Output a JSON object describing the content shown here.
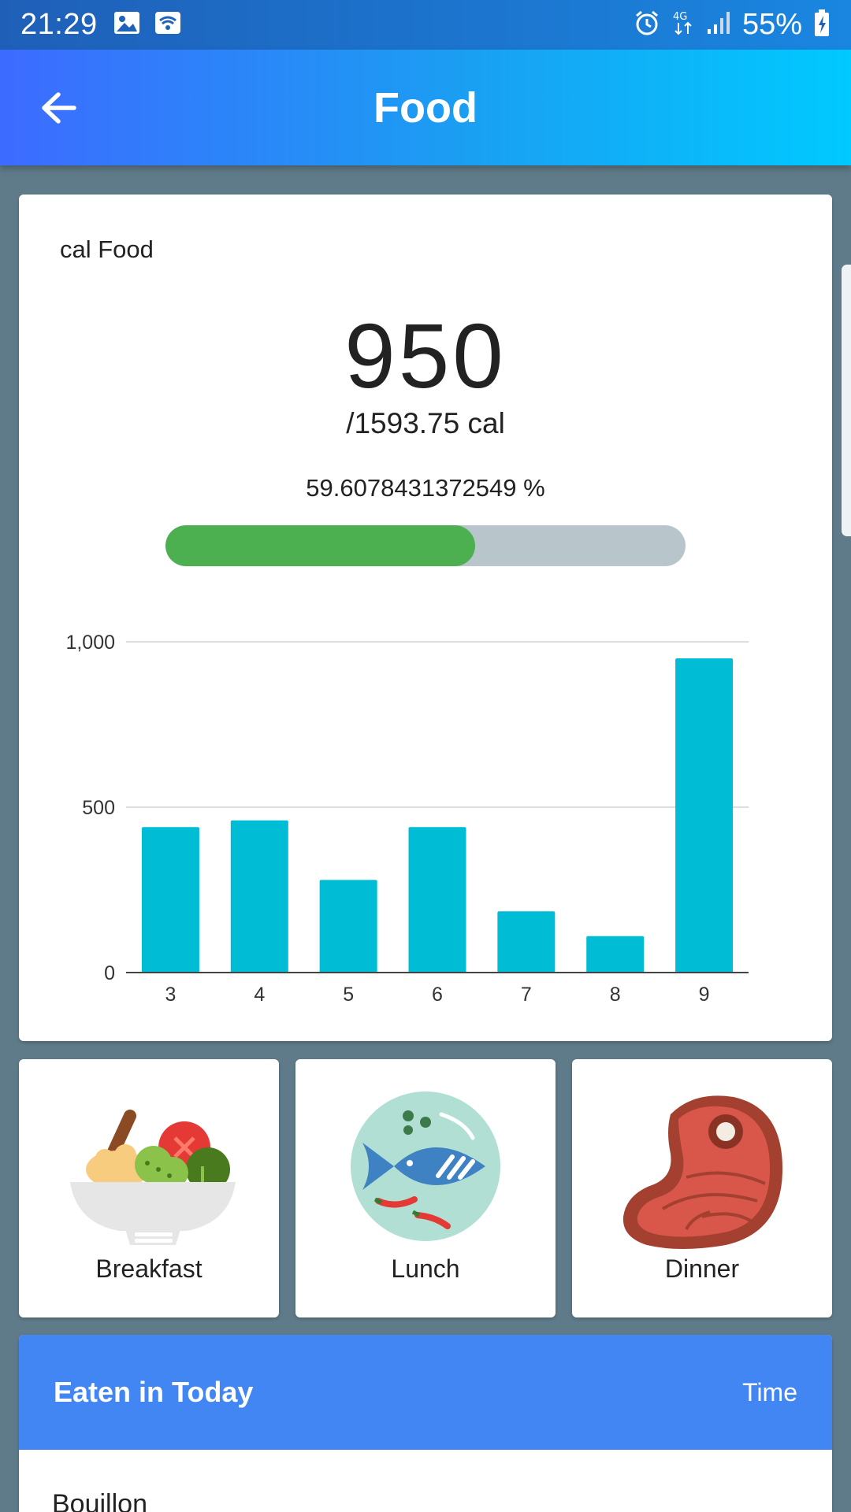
{
  "status_bar": {
    "time": "21:29",
    "battery": "55%",
    "network": "4G",
    "icons": [
      "image-icon",
      "wifi-icon",
      "alarm-icon",
      "network-4g-icon",
      "signal-icon",
      "battery-charging-icon"
    ]
  },
  "app_bar": {
    "title": "Food",
    "back_icon": "arrow-back-icon"
  },
  "summary": {
    "label": "cal Food",
    "consumed": "950",
    "goal": "/1593.75 cal",
    "percent_text": "59.6078431372549 %",
    "progress_fraction": 0.596,
    "progress_color": "#4caf50",
    "track_color": "#b8c6cc"
  },
  "chart_data": {
    "type": "bar",
    "categories": [
      "3",
      "4",
      "5",
      "6",
      "7",
      "8",
      "9"
    ],
    "values": [
      440,
      460,
      280,
      440,
      185,
      110,
      950
    ],
    "ylim": [
      0,
      1000
    ],
    "yticks": [
      "0",
      "500",
      "1,000"
    ],
    "ytick_values": [
      0,
      500,
      1000
    ],
    "grid": true,
    "bar_color": "#00bcd4",
    "title": "",
    "xlabel": "",
    "ylabel": ""
  },
  "meals": [
    {
      "label": "Breakfast",
      "icon": "salad-bowl-icon"
    },
    {
      "label": "Lunch",
      "icon": "fish-plate-icon"
    },
    {
      "label": "Dinner",
      "icon": "steak-icon"
    }
  ],
  "eaten": {
    "title": "Eaten in Today",
    "time_label": "Time",
    "items": [
      "Bouillon"
    ],
    "header_color": "#4286f4"
  }
}
